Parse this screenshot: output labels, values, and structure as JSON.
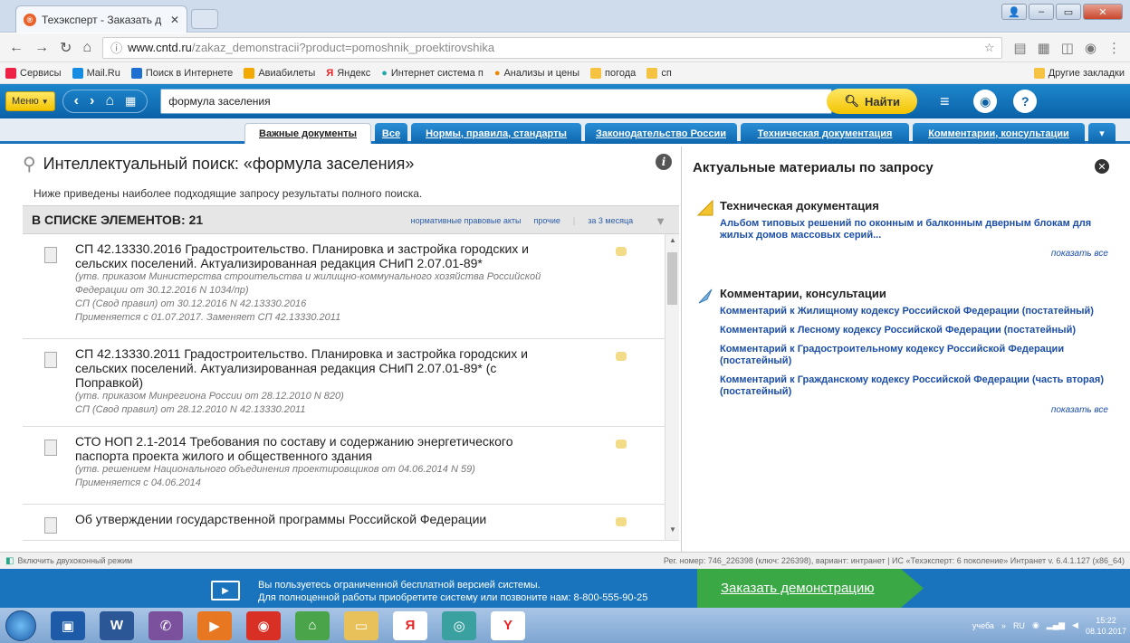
{
  "browser": {
    "tab_title": "Техэксперт - Заказать д",
    "url_host": "www.cntd.ru",
    "url_path": "/zakaz_demonstracii?product=pomoshnik_proektirovshika",
    "bookmarks": [
      "Сервисы",
      "Mail.Ru",
      "Поиск в Интернете",
      "Авиабилеты",
      "Яндекс",
      "Интернет система п",
      "Анализы и цены",
      "погода",
      "сп"
    ],
    "other_bookmarks": "Другие закладки"
  },
  "app": {
    "menu_label": "Меню",
    "search_value": "формула заселения",
    "find_label": "Найти"
  },
  "tabs": [
    {
      "label": "Важные документы",
      "active": true
    },
    {
      "label": "Все",
      "active": false
    },
    {
      "label": "Нормы, правила, стандарты",
      "active": false
    },
    {
      "label": "Законодательство России",
      "active": false
    },
    {
      "label": "Техническая документация",
      "active": false
    },
    {
      "label": "Комментарии, консультации",
      "active": false
    }
  ],
  "left": {
    "title": "Интеллектуальный поиск: «формула заселения»",
    "subtitle": "Ниже приведены наиболее подходящие запросу результаты полного поиска.",
    "count_label": "В СПИСКЕ ЭЛЕМЕНТОВ: 21",
    "filters": [
      "нормативные правовые акты",
      "прочие",
      "за 3 месяца"
    ],
    "items": [
      {
        "title": "СП 42.13330.2016 Градостроительство. Планировка и застройка городских и сельских поселений. Актуализированная редакция СНиП 2.07.01-89*",
        "meta": [
          "(утв. приказом Министерства строительства и жилищно-коммунального хозяйства Российской Федерации от 30.12.2016 N 1034/пр)",
          "СП (Свод правил) от 30.12.2016 N 42.13330.2016",
          "Применяется с 01.07.2017. Заменяет СП 42.13330.2011"
        ]
      },
      {
        "title": "СП 42.13330.2011 Градостроительство. Планировка и застройка городских и сельских поселений. Актуализированная редакция СНиП 2.07.01-89* (с Поправкой)",
        "meta": [
          "(утв. приказом Минрегиона России от 28.12.2010 N 820)",
          "СП (Свод правил) от 28.12.2010 N 42.13330.2011"
        ]
      },
      {
        "title": "СТО НОП 2.1-2014 Требования по составу и содержанию энергетического паспорта проекта жилого и общественного здания",
        "meta": [
          "(утв. решением Национального объединения проектировщиков от 04.06.2014 N 59)",
          "Применяется с 04.06.2014"
        ]
      },
      {
        "title": "Об утверждении государственной программы Российской Федерации",
        "meta": []
      }
    ]
  },
  "right": {
    "title": "Актуальные материалы по запросу",
    "sections": [
      {
        "heading": "Техническая документация",
        "links": [
          "Альбом типовых решений по оконным и балконным дверным блокам для жилых домов массовых серий..."
        ],
        "more": "показать все"
      },
      {
        "heading": "Комментарии, консультации",
        "links": [
          "Комментарий к Жилищному кодексу Российской Федерации (постатейный)",
          "Комментарий к Лесному кодексу Российской Федерации (постатейный)",
          "Комментарий к Градостроительному кодексу Российской Федерации (постатейный)",
          "Комментарий к Гражданскому кодексу Российской Федерации (часть вторая) (постатейный)"
        ],
        "more": "показать все"
      }
    ]
  },
  "status": {
    "left": "Включить двухоконный режим",
    "right": "Рег. номер: 746_226398 (ключ: 226398), вариант: интранет   |   ИС «Техэксперт: 6 поколение» Интранет v. 6.4.1.127 (x86_64)"
  },
  "promo": {
    "line1": "Вы пользуетесь ограниченной бесплатной версией системы.",
    "line2": "Для полноценной работы приобретите систему или позвоните нам: 8-800-555-90-25",
    "button": "Заказать демонстрацию"
  },
  "taskbar": {
    "tray_label": "учеба",
    "lang": "RU",
    "time": "15:22",
    "date": "08.10.2017"
  }
}
